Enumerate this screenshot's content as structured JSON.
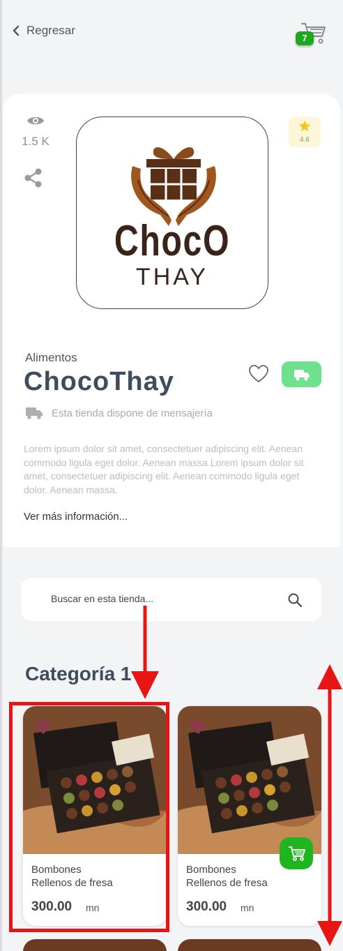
{
  "header": {
    "back_label": "Regresar",
    "cart_count": "7"
  },
  "store": {
    "views": "1.5 K",
    "rating": "4.6",
    "logo_line1": "ChocO",
    "logo_line2": "THAY",
    "category": "Alimentos",
    "name": "ChocoThay",
    "delivery_text": "Esta tienda dispone de mensajería",
    "description": "Lorem ipsum dolor sit amet, consectetuer adipiscing elit. Aenean commodo ligula eget dolor. Aenean massa Lorem ipsum dolor sit amet, consectetuer adipiscing elit. Aenean commodo ligula eget dolor. Aenean massa.",
    "more_link": "Ver más información..."
  },
  "search": {
    "placeholder": "Buscar en esta tienda..."
  },
  "section": {
    "title": "Categoría 1",
    "products": [
      {
        "name_line1": "Bombones",
        "name_line2": "Rellenos de fresa",
        "price": "300.00",
        "unit": "mn"
      },
      {
        "name_line1": "Bombones",
        "name_line2": "Rellenos de fresa",
        "price": "300.00",
        "unit": "mn"
      }
    ]
  },
  "colors": {
    "accent_green": "#1fb51f",
    "delivery_green": "#6fe08d",
    "title_slate": "#3e4c5e",
    "annotation_red": "#e81515"
  },
  "icons": [
    "chevron-left-icon",
    "cart-icon",
    "eye-icon",
    "share-icon",
    "star-icon",
    "heart-icon",
    "truck-icon",
    "search-icon",
    "add-cart-icon"
  ]
}
